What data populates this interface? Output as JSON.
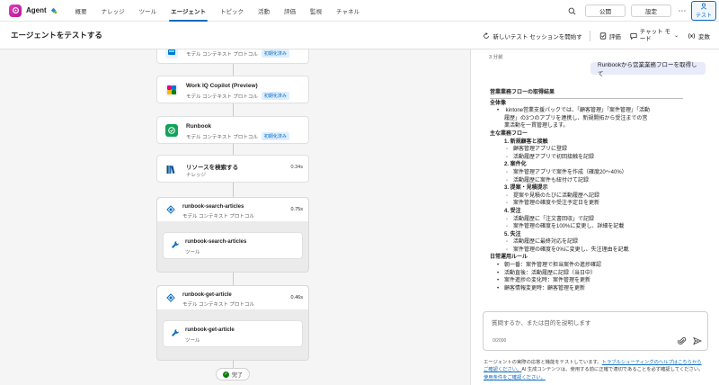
{
  "app": {
    "name": "Agent",
    "logo_icon": "copilot-agent-logo"
  },
  "nav": {
    "tabs": [
      "概要",
      "ナレッジ",
      "ツール",
      "エージェント",
      "トピック",
      "活動",
      "評価",
      "監視",
      "チャネル"
    ],
    "active_tab": "エージェント",
    "publish_label": "公開",
    "settings_label": "設定",
    "test_label": "テスト"
  },
  "header": {
    "title": "エージェントをテストする",
    "new_session_label": "新しいテスト セッションを開始す",
    "evaluate_label": "評価",
    "chat_mode_line1": "チャット モ",
    "chat_mode_line2": "ード",
    "variables_label": "変数"
  },
  "flow": {
    "nodes": [
      {
        "title": "",
        "subtitle": "モデル コンテキスト プロトコル",
        "badge": "初期化済み",
        "icon": "azure-icon"
      },
      {
        "title": "Work IQ Copilot (Preview)",
        "subtitle": "モデル コンテキスト プロトコル",
        "badge": "初期化済み",
        "icon": "workiq-icon"
      },
      {
        "title": "Runbook",
        "subtitle": "モデル コンテキスト プロトコル",
        "badge": "初期化済み",
        "icon": "runbook-icon"
      },
      {
        "title": "リソースを検索する",
        "subtitle": "ナレッジ",
        "time": "0.34s",
        "icon": "books-icon"
      }
    ],
    "groups": [
      {
        "title": "runbook-search-articles",
        "subtitle": "モデル コンテキスト プロトコル",
        "time": "0.75s",
        "inner_title": "runbook-search-articles",
        "inner_subtitle": "ツール"
      },
      {
        "title": "runbook-get-article",
        "subtitle": "モデル コンテキスト プロトコル",
        "time": "0.46s",
        "inner_title": "runbook-get-article",
        "inner_subtitle": "ツール"
      }
    ],
    "done_label": "完了"
  },
  "chat": {
    "timestamp": "3 分前",
    "user_message": "Runbookから営業業務フローを取得して",
    "answer": {
      "title": "営業業務フローの取得結果",
      "overview_heading": "全体像",
      "overview_line1": "kintone営業支援パックでは、「顧客管理」「案件管理」「活動",
      "overview_line2": "履歴」の3つのアプリを連携し、新規開拓から受注までの営",
      "overview_line3": "業活動を一貫管理します。",
      "flow_heading": "主な業務フロー",
      "steps": [
        {
          "title": "1. 新規顧客と接触",
          "items": [
            "顧客管理アプリに登録",
            "活動履歴アプリで初回接触を記録"
          ]
        },
        {
          "title": "2. 案件化",
          "items": [
            "案件管理アプリで案件を作成（確度20〜40%）",
            "活動履歴に案件も紐付けて記録"
          ]
        },
        {
          "title": "3. 提案・見積提示",
          "items": [
            "提案や見積のたびに活動履歴へ記録",
            "案件管理の確度や受注予定日を更新"
          ]
        },
        {
          "title": "4. 受注",
          "items": [
            "活動履歴に「注文書回収」で記録",
            "案件管理の確度を100%に変更し、詳細を記載"
          ]
        },
        {
          "title": "5. 失注",
          "items": [
            "活動履歴に最終対応を記録",
            "案件管理の確度を0%に変更し、失注理由を記載"
          ]
        }
      ],
      "rules_heading": "日常運用ルール",
      "rules": [
        "朝一番：案件管理で担当案件の進捗確認",
        "活動直後：活動履歴に記録（当日中）",
        "案件進捗の変化時：案件管理を更新",
        "顧客情報変更時：顧客管理を更新"
      ]
    },
    "composer_placeholder": "質問するか、または目的を説明します",
    "char_count": "0/2000",
    "disclaimer_pre": "エージェントの実際の応答と機能をテストしています。",
    "disclaimer_link1": "トラブルシューティングのヘルプはこちらから",
    "disclaimer_link1b": "ご確認ください。",
    "disclaimer_mid": "AI 生成コンテンツは、使用する前に正確で適切であることを必ず確認してください。",
    "disclaimer_link2": "使用条件をご確認ください。"
  },
  "colors": {
    "accent": "#0f6cbd",
    "success": "#107c10"
  }
}
